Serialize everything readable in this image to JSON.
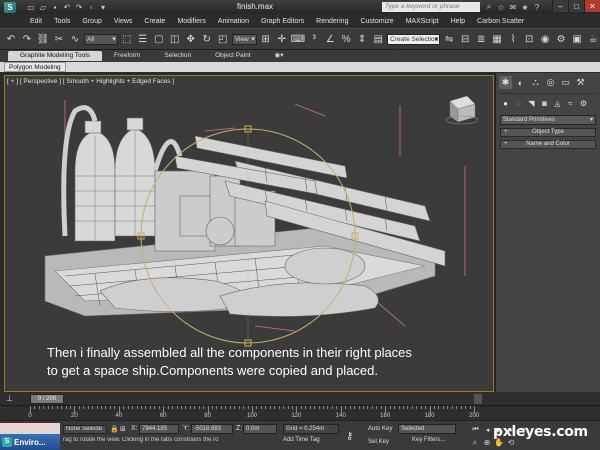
{
  "window": {
    "title": "finish.max",
    "search_placeholder": "Type a keyword or phrase",
    "app_logo": "3ds-max-logo"
  },
  "menu": [
    "Edit",
    "Tools",
    "Group",
    "Views",
    "Create",
    "Modifiers",
    "Animation",
    "Graph Editors",
    "Rendering",
    "Customize",
    "MAXScript",
    "Help",
    "Carbon Scatter"
  ],
  "toolbar": {
    "selection_filter": "All",
    "reference_coord": "View",
    "named_selection": "Create Selection Se"
  },
  "ribbon": {
    "tabs": [
      "Graphite Modeling Tools",
      "Freeform",
      "Selection",
      "Object Paint"
    ],
    "active_tab": "Graphite Modeling Tools",
    "panel_label": "Polygon Modeling"
  },
  "viewport": {
    "label": "[ + ] [ Perspective ] [ Smooth + Highlights + Edged Faces ]",
    "caption_line1": "Then i finally assembled all the components in their right places",
    "caption_line2": "to get a space ship.Components were copied and placed."
  },
  "command_panel": {
    "dropdown": "Standard Primitives",
    "rollouts": [
      "Object Type",
      "Name and Color"
    ]
  },
  "timeline": {
    "frame": "0 / 200",
    "ticks": [
      "0",
      "20",
      "40",
      "60",
      "80",
      "100",
      "120",
      "140",
      "160",
      "180",
      "200"
    ]
  },
  "status": {
    "taskbar_label": "Enviro...",
    "selection": "None Selecte",
    "prompt": "rag to rotate the view.  Clicking in the tabs constrains the ro",
    "x_label": "X:",
    "x_value": "7844.185",
    "y_label": "Y:",
    "y_value": "-5018.883",
    "z_label": "Z:",
    "z_value": "0.0m",
    "grid": "Grid = 0.254m",
    "add_time_tag": "Add Time Tag",
    "auto_key": "Auto Key",
    "set_key": "Set Key",
    "key_mode": "Selected",
    "key_filters": "Key Filters..."
  },
  "watermark": "pxleyes.com"
}
